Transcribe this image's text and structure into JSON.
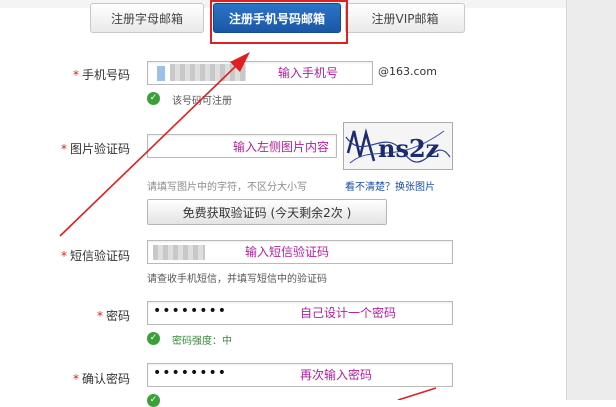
{
  "tabs": [
    {
      "label": "注册字母邮箱"
    },
    {
      "label": "注册手机号码邮箱"
    },
    {
      "label": "注册VIP邮箱"
    }
  ],
  "form": {
    "phone": {
      "label": "手机号码",
      "hint": "输入手机号",
      "suffix": "@163.com",
      "status": "该号码可注册"
    },
    "captcha": {
      "label": "图片验证码",
      "hint": "输入左侧图片内容",
      "help": "请填写图片中的字符，不区分大小写",
      "refresh": "看不清楚？换张图片",
      "captcha_text": "ns2z"
    },
    "sms_button": {
      "label": "免费获取验证码 (今天剩余2次 )"
    },
    "sms": {
      "label": "短信验证码",
      "hint": "输入短信验证码",
      "help": "请查收手机短信，并填写短信中的验证码"
    },
    "password": {
      "label": "密码",
      "value": "••••••••",
      "hint": "自己设计一个密码",
      "strength": "密码强度：中"
    },
    "confirm": {
      "label": "确认密码",
      "value": "••••••••",
      "hint": "再次输入密码"
    }
  },
  "colors": {
    "annotation": "#e02020",
    "hint": "#b020a0",
    "tab_active": "#1f64b5"
  }
}
